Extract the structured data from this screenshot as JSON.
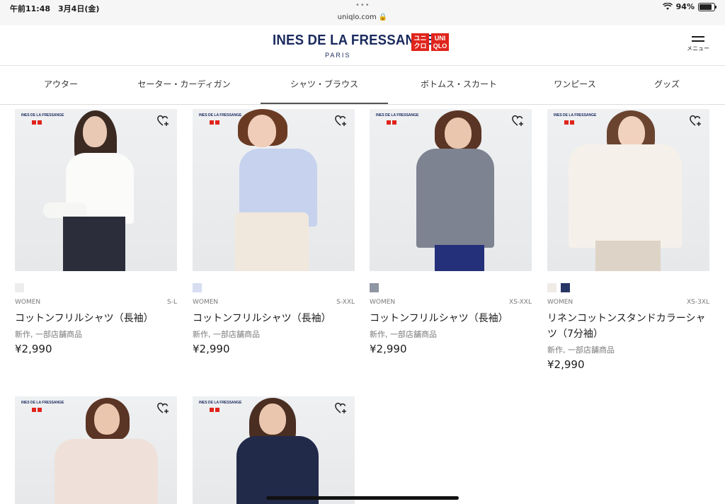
{
  "status_bar": {
    "time": "午前11:48　3月4日(金)",
    "url": "uniqlo.com",
    "battery": "94%",
    "battery_level": 0.94
  },
  "header": {
    "brand": "INES DE LA FRESSANGE",
    "brand_sub": "PARIS",
    "uniqlo_kana": "ユニ クロ",
    "uniqlo_latin": "UNI QLO",
    "menu_label": "メニュー"
  },
  "categories": [
    {
      "label": "アウター",
      "active": false
    },
    {
      "label": "セーター・カーディガン",
      "active": false
    },
    {
      "label": "シャツ・ブラウス",
      "active": true
    },
    {
      "label": "ボトムス・スカート",
      "active": false
    },
    {
      "label": "ワンピース",
      "active": false
    },
    {
      "label": "グッズ",
      "active": false
    }
  ],
  "products": [
    {
      "gender": "WOMEN",
      "sizes": "S-L",
      "name": "コットンフリルシャツ（長袖）",
      "note": "新作, 一部店舗商品",
      "price": "¥2,990",
      "swatches": [
        "#ededed"
      ]
    },
    {
      "gender": "WOMEN",
      "sizes": "S-XXL",
      "name": "コットンフリルシャツ（長袖）",
      "note": "新作, 一部店舗商品",
      "price": "¥2,990",
      "swatches": [
        "#d7def2"
      ]
    },
    {
      "gender": "WOMEN",
      "sizes": "XS-XXL",
      "name": "コットンフリルシャツ（長袖）",
      "note": "新作, 一部店舗商品",
      "price": "¥2,990",
      "swatches": [
        "#8e95a3"
      ]
    },
    {
      "gender": "WOMEN",
      "sizes": "XS-3XL",
      "name": "リネンコットンスタンドカラーシャツ（7分袖）",
      "note": "新作, 一部店舗商品",
      "price": "¥2,990",
      "swatches": [
        "#efebe6",
        "#283666"
      ]
    },
    {
      "gender": "",
      "sizes": "",
      "name": "",
      "note": "",
      "price": "",
      "swatches": []
    },
    {
      "gender": "",
      "sizes": "",
      "name": "",
      "note": "",
      "price": "",
      "swatches": []
    }
  ],
  "mini_brand": "INES DE LA FRESSANGE",
  "colors": {
    "brand_navy": "#1a2a5e",
    "uniqlo_red": "#e0241c"
  }
}
